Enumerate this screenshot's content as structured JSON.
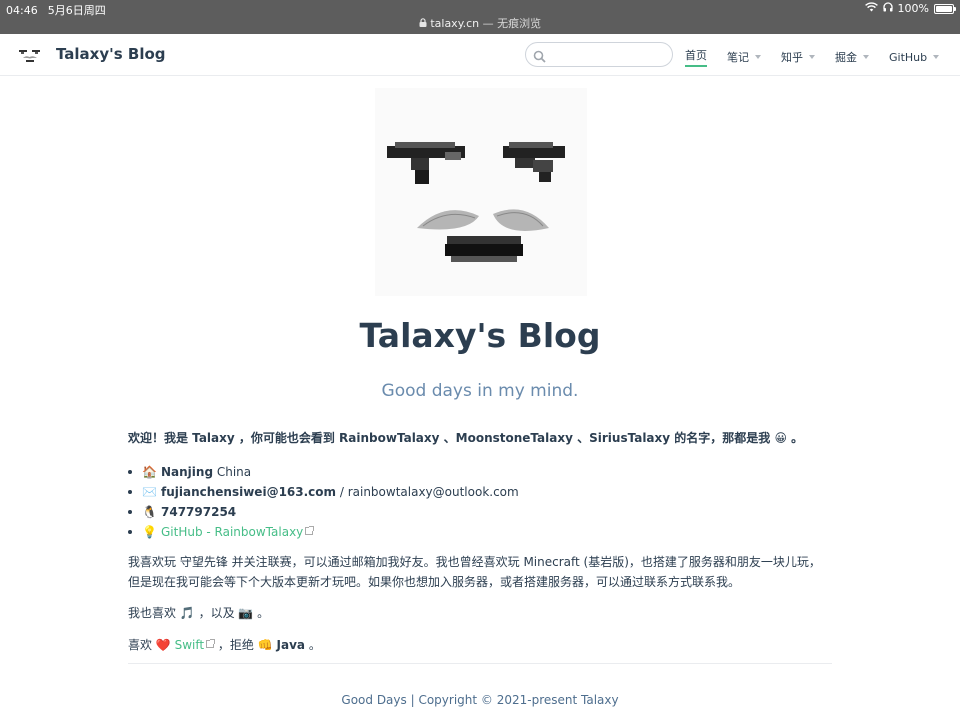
{
  "status_bar": {
    "time": "04:46",
    "date": "5月6日周四",
    "battery": "100%",
    "battery_level": 1.0
  },
  "url_bar": {
    "domain": "talaxy.cn",
    "mode": " — 无痕浏览"
  },
  "navbar": {
    "site_name": "Talaxy's Blog",
    "search_placeholder": "",
    "items": [
      {
        "label": "首页",
        "dropdown": false,
        "active": true
      },
      {
        "label": "笔记",
        "dropdown": true
      },
      {
        "label": "知乎",
        "dropdown": true
      },
      {
        "label": "掘金",
        "dropdown": true
      },
      {
        "label": "GitHub",
        "dropdown": true
      }
    ]
  },
  "hero": {
    "title": "Talaxy's Blog",
    "description": "Good days in my mind."
  },
  "content": {
    "welcome": "欢迎！我是 Talaxy ，你可能也会看到 RainbowTalaxy 、MoonstoneTalaxy 、SiriusTalaxy 的名字，那都是我 😀 。",
    "info": [
      {
        "icon": "🏠",
        "strong": "Nanjing",
        "rest": " China"
      },
      {
        "icon": "✉️",
        "strong": "fujianchensiwei@163.com",
        "rest": " / rainbowtalaxy@outlook.com"
      },
      {
        "icon": "🐧",
        "strong": "747797254",
        "rest": ""
      },
      {
        "icon": "💡",
        "link": "GitHub - RainbowTalaxy"
      }
    ],
    "games": "我喜欢玩 守望先锋 并关注联赛，可以通过邮箱加我好友。我也曾经喜欢玩 Minecraft (基岩版)，也搭建了服务器和朋友一块儿玩，但是现在我可能会等下个大版本更新才玩吧。如果你也想加入服务器，或者搭建服务器，可以通过联系方式联系我。",
    "likes": "我也喜欢 🎵 ，以及 📷 。",
    "swift": {
      "prefix": "喜欢 ",
      "heart": "❤️",
      "link": "Swift",
      "middle": " ，拒绝 ",
      "fist": "👊",
      "java": "Java",
      "suffix": " 。"
    }
  },
  "footer": {
    "text": "Good Days | Copyright © 2021-present Talaxy"
  },
  "colors": {
    "accent": "#46bd87",
    "text": "#2c3e50",
    "subtitle": "#6a8bad"
  }
}
